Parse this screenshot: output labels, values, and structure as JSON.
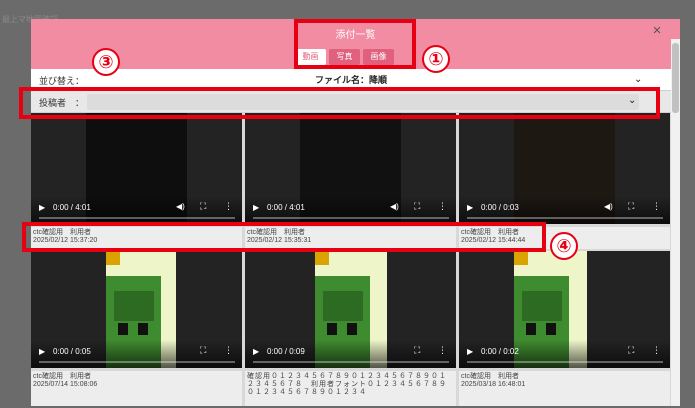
{
  "background": {
    "items": [
      "最上マ地図確認",
      "",
      "",
      "",
      "",
      "",
      "",
      ""
    ]
  },
  "modal": {
    "title": "添付一覧",
    "close_label": "×",
    "tabs": [
      {
        "label": "動画",
        "active": true
      },
      {
        "label": "写真",
        "active": false
      },
      {
        "label": "画像",
        "active": false
      }
    ],
    "sort": {
      "label": "並び替え：",
      "value": "ファイル名：降順"
    },
    "poster": {
      "label": "投稿者　：",
      "value": ""
    }
  },
  "videos": [
    {
      "time": "0:00 / 4:01",
      "progress": 0.0,
      "has_volume": true,
      "user": "ctc確認用　利用者",
      "datetime": "2025/02/12 15:37:20",
      "thumbnail": "dark"
    },
    {
      "time": "0:00 / 4:01",
      "progress": 0.0,
      "has_volume": true,
      "user": "ctc確認用　利用者",
      "datetime": "2025/02/12 15:35:31",
      "thumbnail": "dark"
    },
    {
      "time": "0:00 / 0:03",
      "progress": 0.0,
      "has_volume": true,
      "user": "ctc確認用　利用者",
      "datetime": "2025/02/12 15:44:44",
      "thumbnail": "dark-brown"
    },
    {
      "time": "0:00 / 0:05",
      "progress": 0.0,
      "has_volume": false,
      "user": "ctc確認用　利用者",
      "datetime": "2025/07/14 15:08:06",
      "thumbnail": "pixel"
    },
    {
      "time": "0:00 / 0:09",
      "progress": 0.0,
      "has_volume": false,
      "user": "確認用０１２３４５６７８９０１２３４５６７８９０１２３４５６７８　利用者フォント０１２３４５６７８９０１２３４５６７８９０１２３４",
      "datetime": "",
      "thumbnail": "pixel"
    },
    {
      "time": "0:00 / 0:02",
      "progress": 0.0,
      "has_volume": false,
      "user": "ctc確認用　利用者",
      "datetime": "2025/03/18 16:48:01",
      "thumbnail": "pixel"
    }
  ],
  "annotations": [
    {
      "number": "①"
    },
    {
      "number": "③"
    },
    {
      "number": "④"
    }
  ],
  "colors": {
    "header": "#f28ca3",
    "tab": "#e0607e",
    "annotation": "#e60012"
  }
}
